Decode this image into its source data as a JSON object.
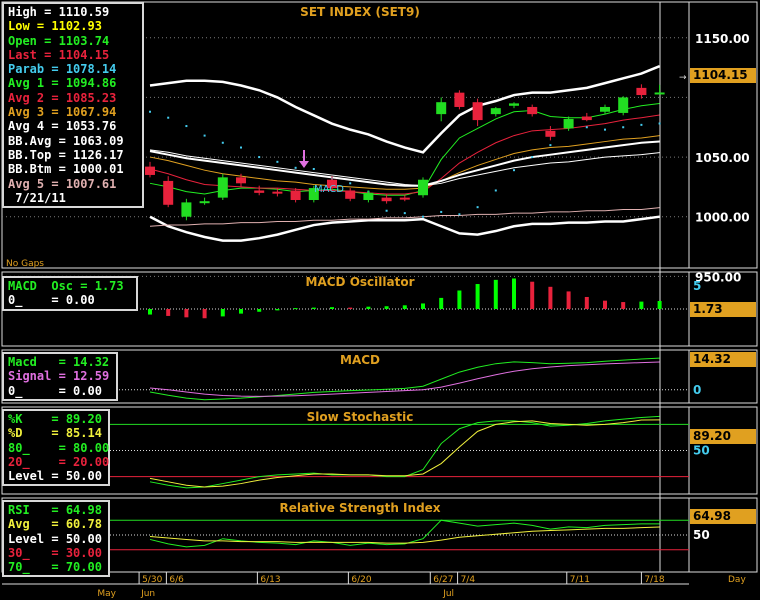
{
  "colors": {
    "panel_border": "#dddddd",
    "grid": "#7a7a7a",
    "title": "#e0a020",
    "white": "#ffffff",
    "green": "#22dd22",
    "red": "#e8223c",
    "yellow": "#f0f03c",
    "cyan": "#44ccee",
    "pink": "#e070e0",
    "bright_green": "#00ff00",
    "value_badge": "#e0a020"
  },
  "chart_data": [
    {
      "panel": "price",
      "type": "candlestick",
      "title": "SET  INDEX  (SET9)",
      "ylim": [
        957,
        1180
      ],
      "y_ticks": [
        1150,
        1100,
        1050,
        1000,
        950
      ],
      "y_tick_labels": [
        "1150.00",
        "",
        "1050.00",
        "1000.00",
        "950.00"
      ],
      "current_value": "1104.15",
      "note": "No  Gaps",
      "annotation": "MACD",
      "legend": [
        {
          "label": "High",
          "value": "1110.59",
          "color": "#ffffff"
        },
        {
          "label": "Low",
          "value": "1102.93",
          "color": "#ffff00"
        },
        {
          "label": "Open",
          "value": "1103.74",
          "color": "#22ee22"
        },
        {
          "label": "Last",
          "value": "1104.15",
          "color": "#e8223c"
        },
        {
          "label": "Parab",
          "value": "1078.14",
          "color": "#44ccee"
        },
        {
          "label": "Avg 1",
          "value": "1094.86",
          "color": "#22ee22"
        },
        {
          "label": "Avg 2",
          "value": "1085.23",
          "color": "#e8223c"
        },
        {
          "label": "Avg 3",
          "value": "1067.94",
          "color": "#e0a020"
        },
        {
          "label": "Avg 4",
          "value": "1053.76",
          "color": "#ffffff"
        },
        {
          "label": "BB.Avg",
          "value": "1063.09",
          "color": "#ffffff"
        },
        {
          "label": "BB.Top",
          "value": "1126.17",
          "color": "#ffffff"
        },
        {
          "label": "BB.Btm",
          "value": "1000.01",
          "color": "#ffffff"
        },
        {
          "label": "Avg 5",
          "value": "1007.61",
          "color": "#e0b0b0"
        },
        {
          "label": "",
          "value": "7/21/11",
          "color": "#ffffff"
        }
      ],
      "candles": [
        {
          "o": 1042,
          "h": 1046,
          "l": 1033,
          "c": 1035
        },
        {
          "o": 1030,
          "h": 1034,
          "l": 1008,
          "c": 1010
        },
        {
          "o": 1000,
          "h": 1015,
          "l": 997,
          "c": 1012
        },
        {
          "o": 1012,
          "h": 1016,
          "l": 1010,
          "c": 1013
        },
        {
          "o": 1016,
          "h": 1036,
          "l": 1014,
          "c": 1033
        },
        {
          "o": 1033,
          "h": 1036,
          "l": 1025,
          "c": 1028
        },
        {
          "o": 1022,
          "h": 1026,
          "l": 1018,
          "c": 1020
        },
        {
          "o": 1021,
          "h": 1024,
          "l": 1017,
          "c": 1020
        },
        {
          "o": 1022,
          "h": 1024,
          "l": 1012,
          "c": 1014
        },
        {
          "o": 1014,
          "h": 1026,
          "l": 1012,
          "c": 1024
        },
        {
          "o": 1031,
          "h": 1034,
          "l": 1022,
          "c": 1024
        },
        {
          "o": 1022,
          "h": 1024,
          "l": 1013,
          "c": 1015
        },
        {
          "o": 1014,
          "h": 1022,
          "l": 1012,
          "c": 1020
        },
        {
          "o": 1016,
          "h": 1019,
          "l": 1011,
          "c": 1013
        },
        {
          "o": 1016,
          "h": 1018,
          "l": 1013,
          "c": 1015
        },
        {
          "o": 1018,
          "h": 1033,
          "l": 1016,
          "c": 1031
        },
        {
          "o": 1086,
          "h": 1100,
          "l": 1080,
          "c": 1096
        },
        {
          "o": 1104,
          "h": 1106,
          "l": 1090,
          "c": 1092
        },
        {
          "o": 1096,
          "h": 1099,
          "l": 1076,
          "c": 1081
        },
        {
          "o": 1086,
          "h": 1092,
          "l": 1084,
          "c": 1091
        },
        {
          "o": 1093,
          "h": 1096,
          "l": 1091,
          "c": 1095
        },
        {
          "o": 1092,
          "h": 1094,
          "l": 1084,
          "c": 1086
        },
        {
          "o": 1072,
          "h": 1076,
          "l": 1064,
          "c": 1067
        },
        {
          "o": 1074,
          "h": 1084,
          "l": 1072,
          "c": 1082
        },
        {
          "o": 1084,
          "h": 1087,
          "l": 1080,
          "c": 1081
        },
        {
          "o": 1088,
          "h": 1094,
          "l": 1086,
          "c": 1092
        },
        {
          "o": 1087,
          "h": 1101,
          "l": 1085,
          "c": 1100
        },
        {
          "o": 1108,
          "h": 1111,
          "l": 1099,
          "c": 1102
        },
        {
          "o": 1103.74,
          "h": 1110.59,
          "l": 1102.93,
          "c": 1104.15
        }
      ],
      "parabolic": [
        1088,
        1083,
        1076,
        1068,
        1062,
        1058,
        1050,
        1046,
        1041,
        1040,
        1032,
        1028,
        1021,
        1005,
        1003,
        1000,
        1004,
        1002,
        1008,
        1022,
        1039,
        1050,
        1060,
        1078,
        1075,
        1073,
        1075,
        1077,
        1078.14
      ],
      "series": [
        {
          "name": "Avg 1",
          "color": "#22ee22",
          "values": [
            1028,
            1025,
            1021,
            1019,
            1022,
            1024,
            1024,
            1023,
            1021,
            1022,
            1023,
            1021,
            1019,
            1018,
            1018,
            1022,
            1048,
            1066,
            1074,
            1082,
            1088,
            1089,
            1084,
            1083,
            1083,
            1086,
            1090,
            1093,
            1094.86
          ]
        },
        {
          "name": "Avg 2",
          "color": "#e8223c",
          "values": [
            1040,
            1036,
            1031,
            1027,
            1026,
            1025,
            1024,
            1024,
            1023,
            1022,
            1022,
            1021,
            1020,
            1019,
            1019,
            1021,
            1032,
            1045,
            1054,
            1062,
            1068,
            1072,
            1073,
            1074,
            1076,
            1078,
            1081,
            1083,
            1085.23
          ]
        },
        {
          "name": "Avg 3",
          "color": "#e0a020",
          "values": [
            1050,
            1047,
            1043,
            1039,
            1036,
            1034,
            1032,
            1030,
            1029,
            1027,
            1026,
            1025,
            1024,
            1023,
            1023,
            1024,
            1030,
            1037,
            1043,
            1048,
            1053,
            1056,
            1058,
            1059,
            1061,
            1063,
            1065,
            1066,
            1067.94
          ]
        },
        {
          "name": "Avg 4",
          "color": "#ffffff",
          "values": [
            1056,
            1054,
            1051,
            1049,
            1047,
            1045,
            1043,
            1041,
            1039,
            1037,
            1035,
            1033,
            1031,
            1029,
            1027,
            1026,
            1028,
            1032,
            1035,
            1038,
            1041,
            1043,
            1045,
            1046,
            1048,
            1050,
            1051,
            1052,
            1053.76
          ]
        },
        {
          "name": "BB.Avg",
          "color": "#ffffff",
          "values": [
            1055,
            1052,
            1049,
            1047,
            1045,
            1043,
            1041,
            1039,
            1037,
            1035,
            1033,
            1031,
            1029,
            1027,
            1026,
            1026,
            1030,
            1035,
            1039,
            1043,
            1047,
            1050,
            1052,
            1054,
            1056,
            1058,
            1060,
            1062,
            1063.09
          ]
        },
        {
          "name": "BB.Top",
          "color": "#ffffff",
          "values": [
            1110,
            1112,
            1114,
            1114,
            1113,
            1110,
            1106,
            1100,
            1092,
            1085,
            1078,
            1073,
            1069,
            1063,
            1058,
            1054,
            1070,
            1085,
            1093,
            1097,
            1102,
            1104,
            1104,
            1106,
            1108,
            1112,
            1116,
            1120,
            1126.17
          ]
        },
        {
          "name": "BB.Btm",
          "color": "#ffffff",
          "values": [
            1000,
            992,
            987,
            983,
            980,
            980,
            982,
            985,
            989,
            993,
            995,
            996,
            997,
            997,
            997,
            998,
            992,
            986,
            985,
            988,
            992,
            994,
            994,
            995,
            995,
            996,
            996,
            998,
            1000.01
          ]
        },
        {
          "name": "Avg 5",
          "color": "#e0b0b0",
          "values": [
            992,
            993,
            993,
            994,
            994,
            995,
            995,
            996,
            996,
            997,
            997,
            998,
            998,
            999,
            999,
            1000,
            1001,
            1001,
            1002,
            1002,
            1003,
            1003,
            1004,
            1004,
            1005,
            1005,
            1006,
            1006,
            1007.61
          ]
        }
      ]
    },
    {
      "panel": "macd_osc",
      "type": "bar",
      "title": "MACD  Oscillator",
      "ylim": [
        -8,
        8
      ],
      "y_tick_labels": [
        "5"
      ],
      "y_ticks": [
        5
      ],
      "current_value": "1.73",
      "legend": [
        {
          "label": "MACD  Osc",
          "value": "1.73",
          "color": "#22ee22"
        },
        {
          "label": "0_",
          "value": "0.00",
          "color": "#ffffff"
        }
      ],
      "values": [
        -1.2,
        -1.5,
        -1.8,
        -2.0,
        -1.6,
        -1.0,
        -0.6,
        -0.3,
        0.2,
        0.3,
        0.4,
        0.3,
        0.5,
        0.6,
        0.8,
        1.2,
        2.4,
        4.0,
        5.4,
        6.3,
        6.6,
        5.9,
        4.8,
        3.8,
        2.6,
        1.8,
        1.5,
        1.6,
        1.73
      ]
    },
    {
      "panel": "macd",
      "type": "line",
      "title": "MACD",
      "ylim": [
        -6,
        18
      ],
      "y_tick_labels": [
        "0"
      ],
      "y_ticks": [
        0
      ],
      "current_value": "14.32",
      "legend": [
        {
          "label": "Macd",
          "value": "14.32",
          "color": "#22ee22"
        },
        {
          "label": "Signal",
          "value": "12.59",
          "color": "#e070e0"
        },
        {
          "label": "0_",
          "value": "0.00",
          "color": "#ffffff"
        }
      ],
      "series": [
        {
          "name": "Macd",
          "color": "#22ee22",
          "values": [
            -1.0,
            -2.5,
            -3.8,
            -4.5,
            -4.2,
            -3.8,
            -3.2,
            -2.6,
            -1.9,
            -1.2,
            -0.8,
            -0.4,
            -0.1,
            0.2,
            0.6,
            1.6,
            4.8,
            8.0,
            10.2,
            11.8,
            12.6,
            12.3,
            11.8,
            12.0,
            12.3,
            12.9,
            13.4,
            13.9,
            14.32
          ]
        },
        {
          "name": "Signal",
          "color": "#e070e0",
          "values": [
            0.8,
            0.0,
            -1.0,
            -2.0,
            -2.6,
            -2.9,
            -3.0,
            -2.9,
            -2.7,
            -2.4,
            -2.0,
            -1.6,
            -1.2,
            -0.8,
            -0.4,
            0.0,
            1.2,
            3.0,
            5.0,
            6.8,
            8.4,
            9.5,
            10.3,
            10.9,
            11.3,
            11.7,
            12.0,
            12.3,
            12.59
          ]
        }
      ]
    },
    {
      "panel": "stochastic",
      "type": "line",
      "title": "Slow  Stochastic",
      "ylim": [
        0,
        100
      ],
      "y_tick_labels": [
        "50"
      ],
      "y_ticks": [
        50
      ],
      "current_value": "89.20",
      "legend": [
        {
          "label": "%K",
          "value": "89.20",
          "color": "#22ee22"
        },
        {
          "label": "%D",
          "value": "85.14",
          "color": "#f0f03c"
        },
        {
          "label": "80_",
          "value": "80.00",
          "color": "#22ee22"
        },
        {
          "label": "20_",
          "value": "20.00",
          "color": "#e8223c"
        },
        {
          "label": "Level",
          "value": "50.00",
          "color": "#ffffff"
        }
      ],
      "series": [
        {
          "name": "%K",
          "color": "#22ee22",
          "values": [
            14,
            10,
            7,
            8,
            12,
            16,
            20,
            22,
            23,
            24,
            22,
            22,
            22,
            20,
            20,
            28,
            58,
            75,
            82,
            84,
            84,
            82,
            78,
            79,
            81,
            84,
            86,
            88,
            89.2
          ]
        },
        {
          "name": "%D",
          "color": "#f0f03c",
          "values": [
            18,
            14,
            10,
            8,
            9,
            12,
            16,
            19,
            21,
            23,
            23,
            22,
            22,
            21,
            21,
            23,
            35,
            54,
            72,
            80,
            83,
            84,
            81,
            80,
            79,
            80,
            82,
            85,
            85.14
          ]
        }
      ]
    },
    {
      "panel": "rsi",
      "type": "line",
      "title": "Relative  Strength  Index",
      "ylim": [
        0,
        100
      ],
      "y_tick_labels": [
        "50"
      ],
      "y_ticks": [
        50
      ],
      "current_value": "64.98",
      "legend": [
        {
          "label": "RSI",
          "value": "64.98",
          "color": "#22ee22"
        },
        {
          "label": "Avg",
          "value": "60.78",
          "color": "#f0f03c"
        },
        {
          "label": "Level",
          "value": "50.00",
          "color": "#ffffff"
        },
        {
          "label": "30_",
          "value": "30.00",
          "color": "#e8223c"
        },
        {
          "label": "70_",
          "value": "70.00",
          "color": "#22ee22"
        }
      ],
      "series": [
        {
          "name": "RSI",
          "color": "#22ee22",
          "values": [
            44,
            38,
            34,
            36,
            45,
            42,
            40,
            39,
            37,
            42,
            40,
            36,
            39,
            37,
            38,
            45,
            70,
            66,
            62,
            64,
            66,
            63,
            58,
            61,
            60,
            63,
            64,
            65,
            64.98
          ]
        },
        {
          "name": "Avg",
          "color": "#f0f03c",
          "values": [
            48,
            46,
            44,
            42,
            42,
            41,
            41,
            41,
            40,
            40,
            40,
            40,
            40,
            39,
            39,
            40,
            43,
            47,
            49,
            51,
            53,
            55,
            56,
            57,
            58,
            59,
            59,
            60,
            60.78
          ]
        }
      ]
    }
  ],
  "x_axis": {
    "ticks": [
      {
        "label": "5/30",
        "candle": -0.6
      },
      {
        "label": "6/6",
        "candle": 0.9
      },
      {
        "label": "6/13",
        "candle": 5.9
      },
      {
        "label": "6/20",
        "candle": 10.9
      },
      {
        "label": "6/27",
        "candle": 15.4
      },
      {
        "label": "7/4",
        "candle": 16.9
      },
      {
        "label": "7/11",
        "candle": 22.9
      },
      {
        "label": "7/18",
        "candle": 27.0
      }
    ],
    "months": [
      {
        "label": "May",
        "candle": -3.0
      },
      {
        "label": "Jun",
        "candle": -0.6
      },
      {
        "label": "Jul",
        "candle": 16.0
      }
    ],
    "unit_label": "Day"
  }
}
